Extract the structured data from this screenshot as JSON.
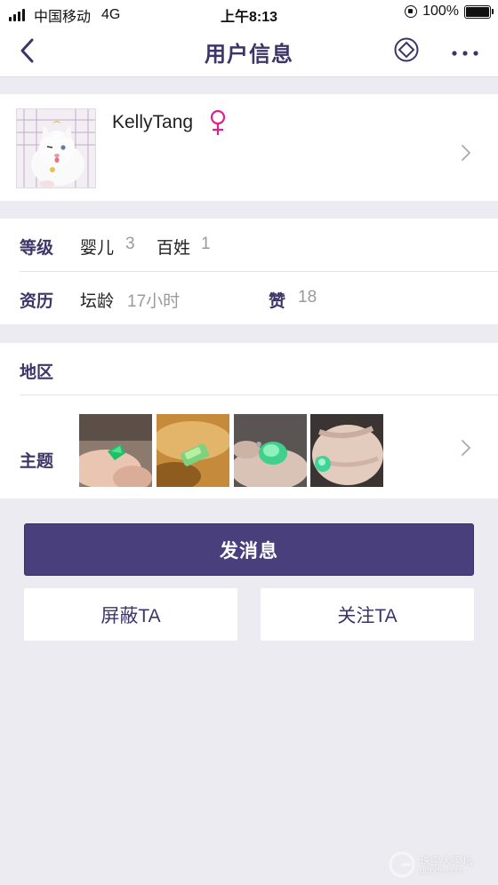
{
  "status_bar": {
    "carrier": "中国移动",
    "network": "4G",
    "time": "上午8:13",
    "battery_text": "100%",
    "battery_level": 1.0
  },
  "nav": {
    "title": "用户信息",
    "back_icon": "chevron-left-icon",
    "diamond_icon": "diamond-coin-icon",
    "more_icon": "more-dots-icon"
  },
  "profile": {
    "username": "KellyTang",
    "gender_icon": "female-icon",
    "gender_color": "#e0218a"
  },
  "level": {
    "label": "等级",
    "items": [
      {
        "name": "婴儿",
        "value": "3"
      },
      {
        "name": "百姓",
        "value": "1"
      }
    ]
  },
  "history": {
    "label": "资历",
    "forum_age_label": "坛龄",
    "forum_age_value": "17小时",
    "likes_label": "赞",
    "likes_value": "18"
  },
  "region": {
    "label": "地区",
    "value": ""
  },
  "topics": {
    "label": "主题",
    "thumbnails": [
      "jade-thumbnail-1",
      "jade-thumbnail-2",
      "jade-thumbnail-3",
      "jade-thumbnail-4"
    ]
  },
  "actions": {
    "send_message": "发消息",
    "block": "屏蔽TA",
    "follow": "关注TA"
  },
  "watermark": {
    "text": "珠宝大家坛",
    "url": "gdbbs.com"
  },
  "colors": {
    "accent": "#3d3568",
    "button": "#4a3f7d",
    "background": "#ebebf1"
  }
}
